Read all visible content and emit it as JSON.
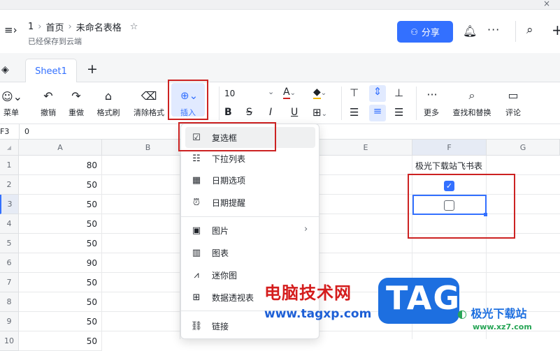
{
  "header": {
    "breadcrumb": [
      "1",
      "首页",
      "未命名表格"
    ],
    "saved_status": "已经保存到云端",
    "share_label": "分享"
  },
  "tabs": {
    "sheet1": "Sheet1",
    "add": "+"
  },
  "toolbar": {
    "menu_label": "菜单",
    "undo": "撤销",
    "redo": "重做",
    "format_painter": "格式刷",
    "clear_format": "清除格式",
    "insert": "插入",
    "font_size": "10",
    "more": "更多",
    "find_replace": "查找和替换",
    "comment": "评论"
  },
  "formula": {
    "cell_ref": "F3",
    "value": "0"
  },
  "grid": {
    "columns": [
      "A",
      "B",
      "C",
      "D",
      "E",
      "F",
      "G"
    ],
    "rows": [
      "1",
      "2",
      "3",
      "4",
      "5",
      "6",
      "7",
      "8",
      "9",
      "10"
    ],
    "colA": [
      "80",
      "50",
      "50",
      "50",
      "50",
      "90",
      "50",
      "50",
      "50",
      "50"
    ],
    "f1": "极光下载站飞书表",
    "f2_checked": true,
    "f3_checked": false
  },
  "insert_menu": {
    "items": [
      "复选框",
      "下拉列表",
      "日期选项",
      "日期提醒",
      "图片",
      "图表",
      "迷你图",
      "数据透视表",
      "链接"
    ]
  },
  "watermark": {
    "site_name": "电脑技术网",
    "site_url": "www.tagxp.com",
    "logo_text": "TAG",
    "brand": "极光下载站",
    "brand_url": "www.xz7.com"
  },
  "colors": {
    "accent": "#3370ff",
    "highlight": "#cc2222",
    "toolbar_active": "#e1eaff"
  }
}
